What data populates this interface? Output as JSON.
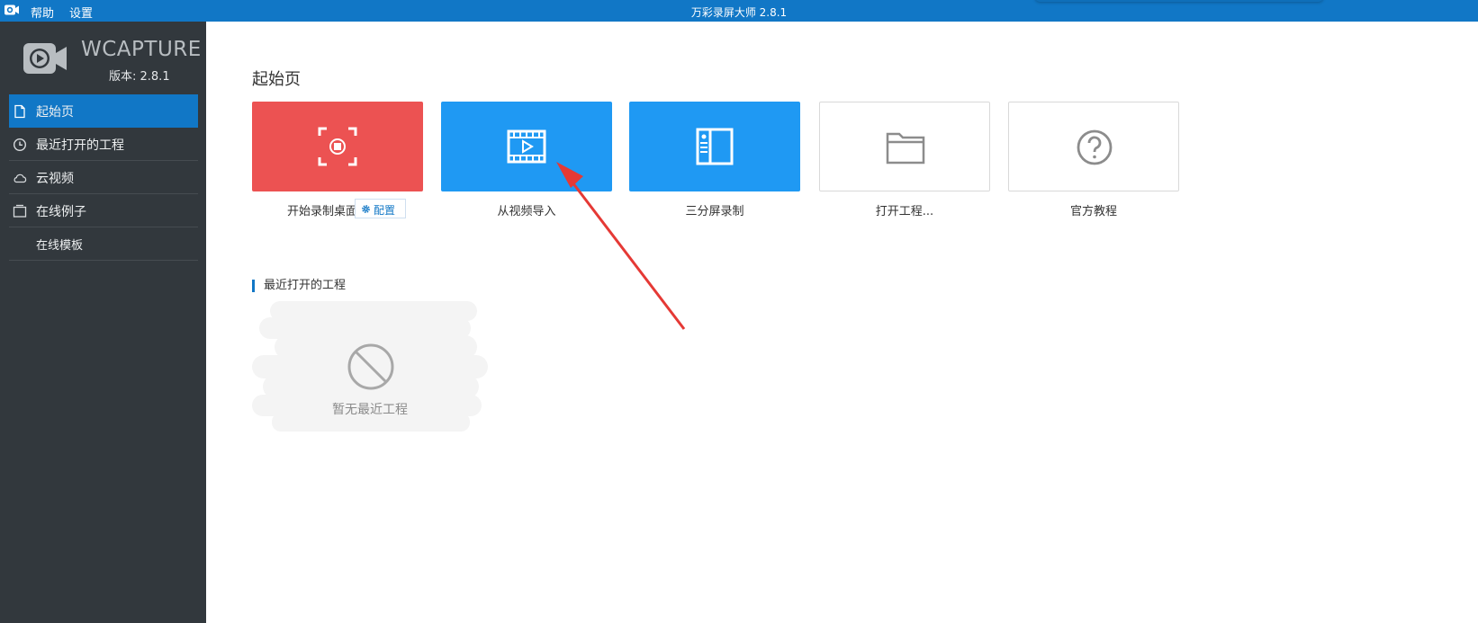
{
  "window": {
    "title": "万彩录屏大师 2.8.1",
    "menus": [
      "帮助",
      "设置"
    ]
  },
  "sidebar": {
    "brand": "WCAPTURE",
    "version": "版本: 2.8.1",
    "items": [
      {
        "label": "起始页",
        "icon": "page-icon",
        "active": true
      },
      {
        "label": "最近打开的工程",
        "icon": "clock-icon",
        "active": false
      },
      {
        "label": "云视频",
        "icon": "cloud-icon",
        "active": false
      },
      {
        "label": "在线例子",
        "icon": "window-icon",
        "active": false
      },
      {
        "label": "在线模板",
        "icon": "",
        "active": false
      }
    ]
  },
  "main": {
    "page_title": "起始页",
    "tiles": [
      {
        "label": "开始录制桌面",
        "icon": "record-desktop-icon",
        "color": "#ec5252"
      },
      {
        "label": "从视频导入",
        "icon": "film-play-icon",
        "color": "#1f99f3"
      },
      {
        "label": "三分屏录制",
        "icon": "split-screen-icon",
        "color": "#1f99f3"
      },
      {
        "label": "打开工程...",
        "icon": "folder-icon",
        "color": "#ffffff"
      },
      {
        "label": "官方教程",
        "icon": "question-circle-icon",
        "color": "#ffffff"
      }
    ],
    "config_button": "配置",
    "recent_section_title": "最近打开的工程",
    "recent_empty_text": "暂无最近工程"
  },
  "colors": {
    "titlebar": "#1177c6",
    "sidebar": "#32383d",
    "accent": "#1177c6",
    "annotation_arrow": "#e53935"
  }
}
